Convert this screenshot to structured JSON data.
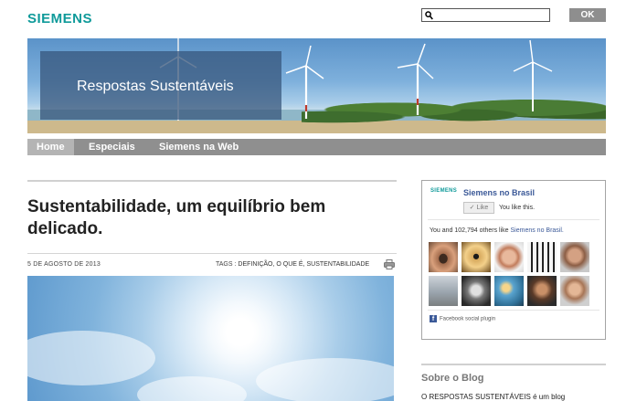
{
  "header": {
    "logo_text": "SIEMENS",
    "search": {
      "value": "",
      "placeholder": ""
    },
    "ok_label": "OK"
  },
  "banner": {
    "title": "Respostas Sustentáveis"
  },
  "nav": {
    "items": [
      {
        "label": "Home",
        "active": true
      },
      {
        "label": "Especiais",
        "active": false
      },
      {
        "label": "Siemens na Web",
        "active": false
      }
    ]
  },
  "post": {
    "title": "Sustentabilidade, um equilíbrio bem delicado.",
    "date": "5 DE AGOSTO DE 2013",
    "tags_label": "TAGS :",
    "tags": [
      "DEFINIÇÃO,",
      "O QUE É,",
      "SUSTENTABILIDADE"
    ]
  },
  "facebook": {
    "logo_text": "SIEMENS",
    "page_name": "Siemens no Brasil",
    "like_label": "Like",
    "like_status": "You like this.",
    "count_prefix": "You and 102,794 others like",
    "count_link": "Siemens no Brasil.",
    "plugin_label": "Facebook social plugin"
  },
  "sidebar": {
    "about_heading": "Sobre o Blog",
    "about_text": "O RESPOSTAS SUSTENTÁVEIS é um blog"
  },
  "colors": {
    "brand": "#0f9a9a",
    "nav_bg": "#8f8f8f",
    "nav_active": "#b4b4b4",
    "facebook_blue": "#3b5998"
  }
}
